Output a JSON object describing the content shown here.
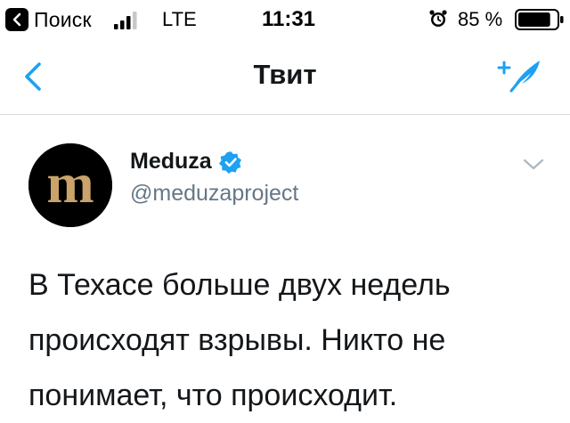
{
  "status_bar": {
    "back_app_label": "Поиск",
    "carrier": "LTE",
    "time": "11:31",
    "battery_percent": "85 %",
    "battery_level": 0.85,
    "icons": [
      "back-to-app-chevron-icon",
      "signal-bars-icon",
      "alarm-icon",
      "battery-icon"
    ]
  },
  "nav": {
    "title": "Твит",
    "back_icon": "chevron-left-icon",
    "compose_icon": "compose-tweet-icon",
    "accent_color": "#1da1f2"
  },
  "tweet": {
    "author": {
      "display_name": "Meduza",
      "handle": "@meduzaproject",
      "verified": true,
      "avatar_text": "m",
      "avatar_bg": "#000000",
      "avatar_fg": "#c9a36a"
    },
    "text": "В Техасе больше двух недель происходят взрывы. Никто не понимает, что происходит.",
    "caret_icon": "chevron-down-icon"
  }
}
